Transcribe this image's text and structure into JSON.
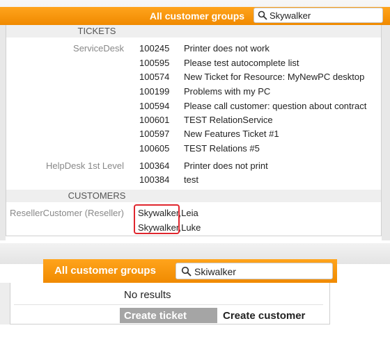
{
  "top": {
    "groups_label": "All customer groups",
    "search_value": "Skywalker",
    "tickets_header": "TICKETS",
    "customers_header": "CUSTOMERS",
    "groups": [
      {
        "name": "ServiceDesk",
        "tickets": [
          {
            "id": "100245",
            "subject": "Printer does not work"
          },
          {
            "id": "100595",
            "subject": "Please test autocomplete list"
          },
          {
            "id": "100574",
            "subject": "New Ticket for Resource: MyNewPC desktop"
          },
          {
            "id": "100199",
            "subject": "Problems with my PC"
          },
          {
            "id": "100594",
            "subject": "Please call customer: question about contract"
          },
          {
            "id": "100601",
            "subject": "TEST RelationService"
          },
          {
            "id": "100597",
            "subject": "New Features Ticket #1"
          },
          {
            "id": "100605",
            "subject": "TEST Relations #5"
          }
        ]
      },
      {
        "name": "HelpDesk 1st Level",
        "tickets": [
          {
            "id": "100364",
            "subject": "Printer does not print"
          },
          {
            "id": "100384",
            "subject": "test"
          }
        ]
      }
    ],
    "customer_group": "ResellerCustomer (Reseller)",
    "customers": [
      {
        "last": "Skywalker",
        "first": "Leia"
      },
      {
        "last": "Skywalker",
        "first": "Luke"
      }
    ]
  },
  "bottom": {
    "groups_label": "All customer groups",
    "search_value": "Skiwalker",
    "no_results": "No results",
    "create_ticket": "Create ticket",
    "create_customer": "Create customer"
  },
  "colors": {
    "orange": "#f7941d",
    "highlight_red": "#e0262e",
    "muted_text": "#888888",
    "create_ticket_bg": "#a5a5a5"
  },
  "icons": {
    "search": "search-icon"
  }
}
